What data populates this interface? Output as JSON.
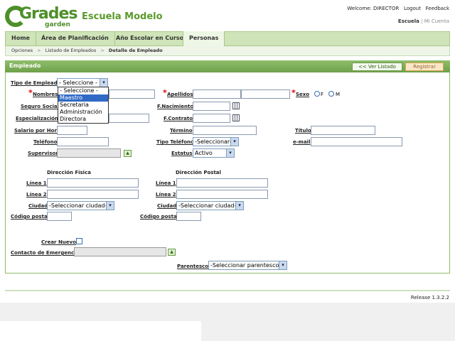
{
  "logo": {
    "text_top": "Grades",
    "text_bottom": "garden"
  },
  "app_title": "Escuela Modelo",
  "user_bar": {
    "welcome": "Welcome: DIRECTOR",
    "logout": "Logout",
    "feedback": "Feedback"
  },
  "context_bar": {
    "school": "Escuela",
    "separator": "|",
    "my_account": "Mi Cuenta"
  },
  "tabs": [
    {
      "label": "Home"
    },
    {
      "label": "Área de Planificación"
    },
    {
      "label": "Año Escolar en Curso"
    },
    {
      "label": "Personas"
    }
  ],
  "breadcrumb": {
    "items": [
      "Opciones",
      "Listado de Empleados",
      "Detalle de Empleado"
    ],
    "sep": ">"
  },
  "panel": {
    "title": "Empleado",
    "back_button": "<< Ver Listado",
    "register_button": "Registrar"
  },
  "form": {
    "tipo_empleado": {
      "label": "Tipo de Empleado",
      "value": "- Seleccione -"
    },
    "tipo_options": [
      "- Seleccione -",
      "Maestro",
      "Secretaria",
      "Administración",
      "Directora"
    ],
    "nombres": "Nombres",
    "apellidos": "Apellidos",
    "sexo": {
      "label": "Sexo",
      "f": "F",
      "m": "M"
    },
    "seguro_social": "Seguro Social",
    "f_nacimiento": "F.Nacimiento",
    "especializacion": "Especialización",
    "f_contrato": "F.Contrato",
    "salario": "Salario por Hora",
    "termino": "Término",
    "titulo": "Título",
    "telefono": "Teléfono",
    "tipo_telefono": {
      "label": "Tipo Teléfono",
      "value": "-Seleccionar-"
    },
    "email": "e-mail",
    "supervisor": "Supervisor",
    "estatus": {
      "label": "Estatus",
      "value": "Activo"
    },
    "dir_fisica": "Dirección Física",
    "dir_postal": "Dirección Postal",
    "linea1": "Línea 1",
    "linea2": "Línea 2",
    "ciudad": "Ciudad",
    "ciudad_placeholder": "-Seleccionar ciudad-",
    "codigo_postal": "Código postal",
    "crear_nuevo": "Crear Nuevo",
    "contacto": "Contacto de Emergencia",
    "parentesco": {
      "label": "Parentesco",
      "value": "-Seleccionar parentesco-"
    }
  },
  "footer": {
    "release": "Release 1.3.2.2"
  },
  "colors": {
    "nav_green": "#cfe4b8",
    "panel_header": "#7fae59",
    "accent_green": "#5a9a2a",
    "required_red": "#dd0000"
  }
}
